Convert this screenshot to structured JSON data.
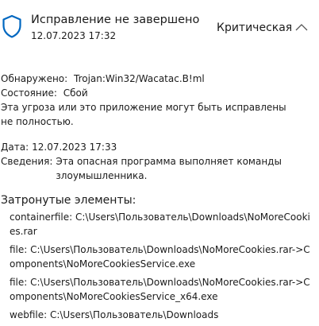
{
  "header": {
    "title": "Исправление не завершено",
    "datetime": "12.07.2023 17:32",
    "severity": "Критическая",
    "icon": "shield-icon",
    "collapse_icon": "chevron-up-icon"
  },
  "details": {
    "detected_label": "Обнаружено:",
    "detected_value": "Trojan:Win32/Wacatac.B!ml",
    "status_label": "Состояние:",
    "status_value": "Сбой",
    "message": "Эта угроза или это приложение могут быть исправлены не полностью.",
    "date_label": "Дата:",
    "date_value": "12.07.2023 17:33",
    "info_label": "Сведения:",
    "info_value": "Эта опасная программа выполняет команды злоумышленника."
  },
  "affected": {
    "title": "Затронутые элементы:",
    "items": [
      "containerfile: C:\\Users\\Пользователь\\Downloads\\NoMoreCookies.rar",
      "file: C:\\Users\\Пользователь\\Downloads\\NoMoreCookies.rar->Components\\NoMoreCookiesService.exe",
      "file: C:\\Users\\Пользователь\\Downloads\\NoMoreCookies.rar->Components\\NoMoreCookiesService_x64.exe",
      "webfile: C:\\Users\\Пользователь\\Downloads"
    ]
  },
  "colors": {
    "accent": "#0067c0",
    "text": "#1b1b1b"
  }
}
